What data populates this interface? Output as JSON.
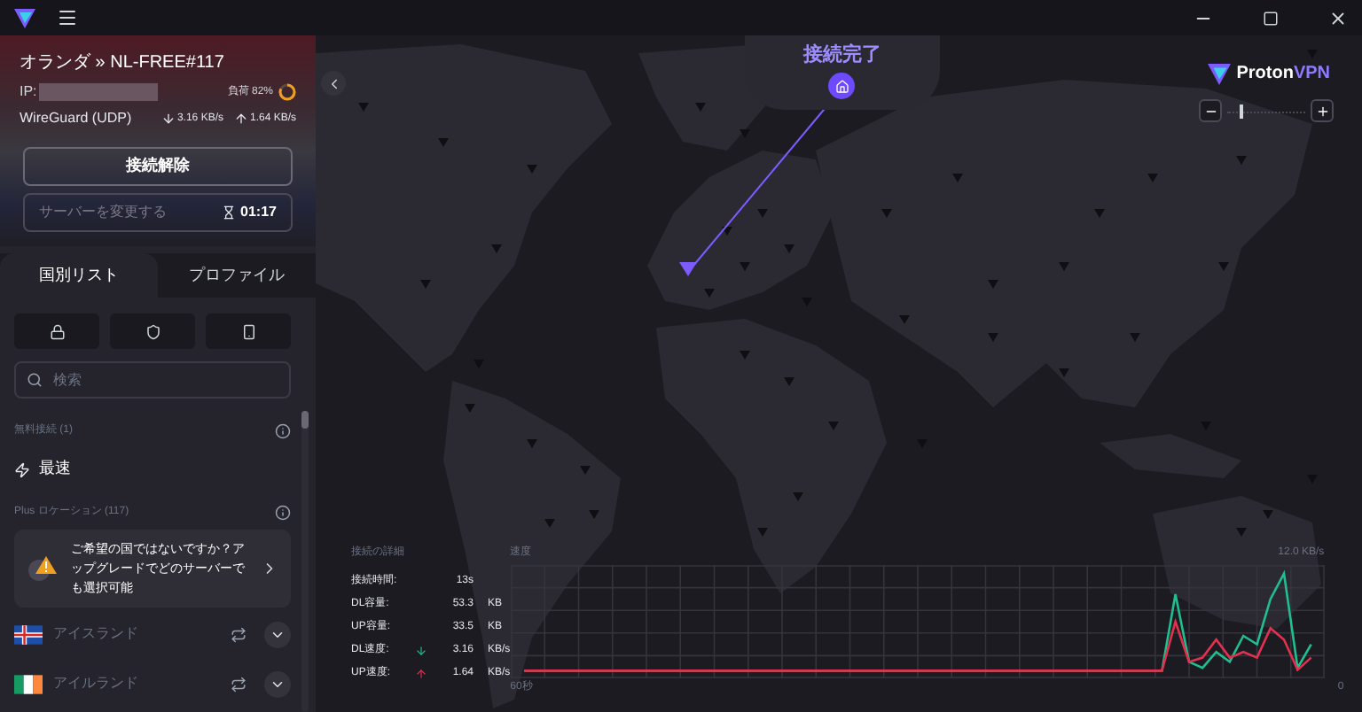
{
  "connection": {
    "title": "オランダ » NL-FREE#117",
    "ip_label": "IP:",
    "load": {
      "label": "負荷 82%"
    },
    "protocol": "WireGuard (UDP)",
    "download": "3.16 KB/s",
    "upload": "1.64 KB/s"
  },
  "disconnect_button": "接続解除",
  "change_server_button": {
    "label": "サーバーを変更する",
    "disabled": true,
    "timer": "01:17"
  },
  "tabs": [
    {
      "label": "国別リスト",
      "selected": true
    },
    {
      "label": "プロファイル",
      "selected": false
    }
  ],
  "search": {
    "placeholder": "検索"
  },
  "free_section": {
    "title": "無料接続 (1)",
    "items": [
      {
        "label": "最速"
      }
    ]
  },
  "plus_section": {
    "title": "Plus ロケーション (117)",
    "upsell": "ご希望の国ではないですか？アップグレードでどのサーバーでも選択可能",
    "countries": [
      {
        "kind": "iceland",
        "label": "アイスランド",
        "locked": true
      },
      {
        "kind": "ireland",
        "label": "アイルランド",
        "locked": true
      }
    ]
  },
  "map": {
    "status": "接続完了",
    "logo": {
      "text": "Proton",
      "accent": "VPN"
    },
    "zoom": {
      "level": 0.15
    }
  },
  "details": {
    "title": "接続の詳細",
    "rows": [
      {
        "label": "接続時間:",
        "value": "13s"
      },
      {
        "label": "DL容量:",
        "value": "53.3",
        "unit": "KB"
      },
      {
        "label": "UP容量:",
        "value": "33.5",
        "unit": "KB"
      },
      {
        "label": "DL速度:",
        "kind": "down",
        "value": "3.16",
        "unit": "KB/s"
      },
      {
        "label": "UP速度:",
        "kind": "up",
        "value": "1.64",
        "unit": "KB/s"
      }
    ]
  },
  "speed": {
    "title": "速度",
    "top_label": "12.0 KB/s",
    "start_label": "60秒",
    "end_label": "0"
  }
}
